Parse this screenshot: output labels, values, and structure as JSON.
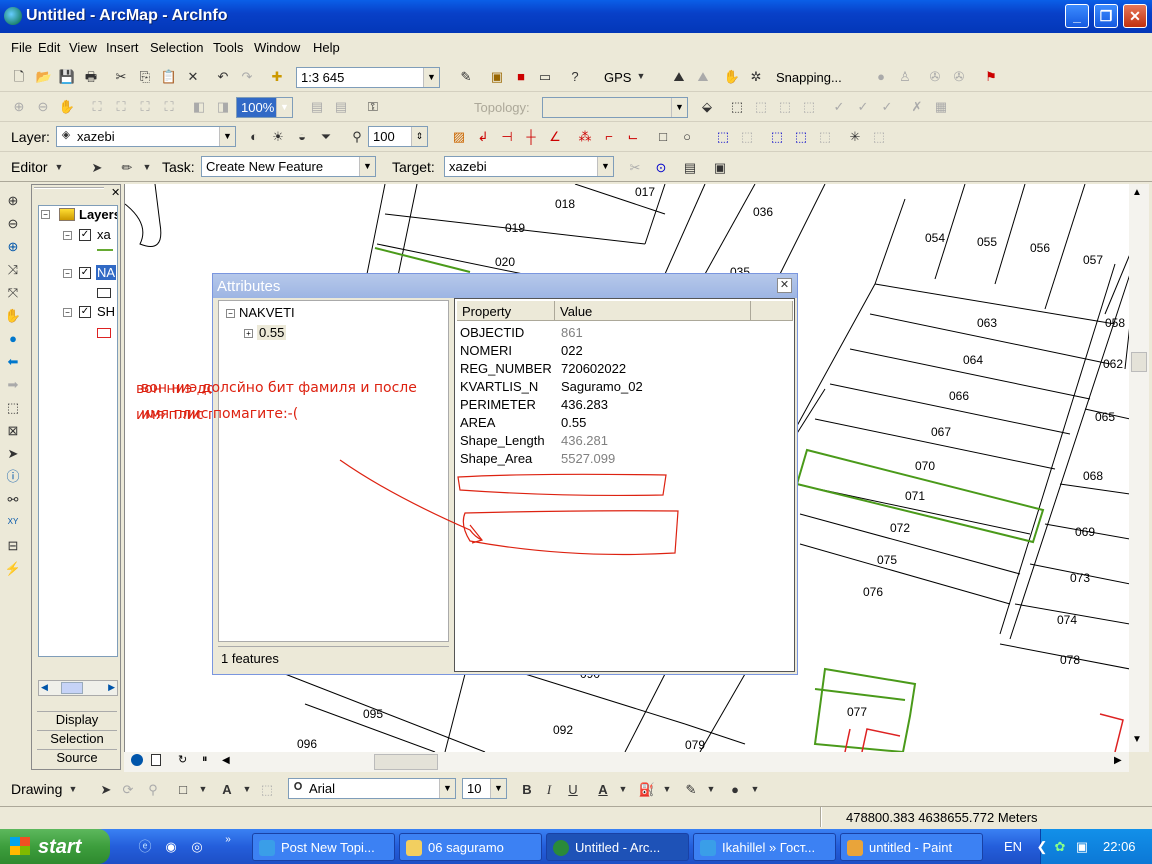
{
  "title_bar": {
    "title": "Untitled - ArcMap - ArcInfo"
  },
  "menu": [
    "File",
    "Edit",
    "View",
    "Insert",
    "Selection",
    "Tools",
    "Window",
    "Help"
  ],
  "standard_toolbar": {
    "scale": "1:3 645",
    "gps_label": "GPS",
    "snapping_label": "Snapping..."
  },
  "layout_toolbar": {
    "zoom": "100%",
    "topology_label": "Topology:",
    "topology_value": ""
  },
  "effects_toolbar": {
    "layer_label": "Layer:",
    "layer_value": "xazebi",
    "transparency": "100"
  },
  "editor_toolbar": {
    "editor_label": "Editor",
    "task_label": "Task:",
    "task_value": "Create New Feature",
    "target_label": "Target:",
    "target_value": "xazebi"
  },
  "toc": {
    "root_label": "Layers",
    "layers": [
      "xa",
      "NA",
      "SH"
    ],
    "tabs": [
      "Display",
      "Selection",
      "Source"
    ]
  },
  "attributes": {
    "title": "Attributes",
    "tree_root": "NAKVETI",
    "tree_child": "0.55",
    "columns": [
      "Property",
      "Value"
    ],
    "rows": [
      {
        "key": "OBJECTID",
        "value": "861"
      },
      {
        "key": "NOMERI",
        "value": "022"
      },
      {
        "key": "REG_NUMBER",
        "value": "720602022"
      },
      {
        "key": "KVARTLIS_N",
        "value": "Saguramo_02"
      },
      {
        "key": "PERIMETER",
        "value": "436.283"
      },
      {
        "key": "AREA",
        "value": "0.55"
      },
      {
        "key": "Shape_Length",
        "value": "436.281"
      },
      {
        "key": "Shape_Area",
        "value": "5527.099"
      }
    ],
    "features": "1 features"
  },
  "annotation": {
    "line1": "вон ниэ долсйно бит фамиля и после",
    "line2": "имя плис помагите:-("
  },
  "parcel_labels": [
    "017",
    "018",
    "019",
    "020",
    "035",
    "036",
    "054",
    "055",
    "056",
    "057",
    "058",
    "063",
    "062",
    "064",
    "066",
    "065",
    "067",
    "070",
    "068",
    "071",
    "072",
    "069",
    "075",
    "073",
    "076",
    "074",
    "078",
    "077",
    "095",
    "092",
    "096",
    "079",
    "090"
  ],
  "drawing_toolbar": {
    "drawing_label": "Drawing",
    "font": "Arial",
    "size": "10"
  },
  "status": {
    "coordinates": "478800.383  4638655.772 Meters"
  },
  "taskbar": {
    "start": "start",
    "tasks": [
      "Post New Topi...",
      "06 saguramo",
      "Untitled - Arc...",
      "Ikahillel » Гост...",
      "untitled - Paint"
    ],
    "lang": "EN",
    "clock": "22:06"
  }
}
